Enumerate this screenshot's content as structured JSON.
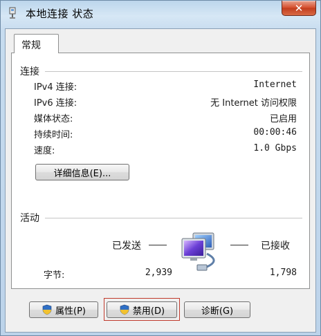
{
  "window": {
    "title": "本地连接 状态",
    "close_label": "✕"
  },
  "tab": {
    "label": "常规"
  },
  "connection": {
    "group_label": "连接",
    "rows": [
      {
        "label": "IPv4 连接:",
        "value": "Internet"
      },
      {
        "label": "IPv6 连接:",
        "value": "无 Internet 访问权限"
      },
      {
        "label": "媒体状态:",
        "value": "已启用"
      },
      {
        "label": "持续时间:",
        "value": "00:00:46"
      },
      {
        "label": "速度:",
        "value": "1.0 Gbps"
      }
    ],
    "details_button": "详细信息(E)..."
  },
  "activity": {
    "group_label": "活动",
    "sent_label": "已发送",
    "received_label": "已接收",
    "bytes_label": "字节:",
    "bytes_sent": "2,939",
    "bytes_received": "1,798"
  },
  "buttons": {
    "properties": "属性(P)",
    "disable": "禁用(D)",
    "diagnose": "诊断(G)"
  },
  "colors": {
    "highlight": "#c0392b",
    "shield_blue": "#2f6fc5",
    "shield_yellow": "#f2c230"
  },
  "icons": {
    "title": "network-adapter-icon",
    "activity": "network-computers-icon",
    "shield": "uac-shield-icon"
  }
}
